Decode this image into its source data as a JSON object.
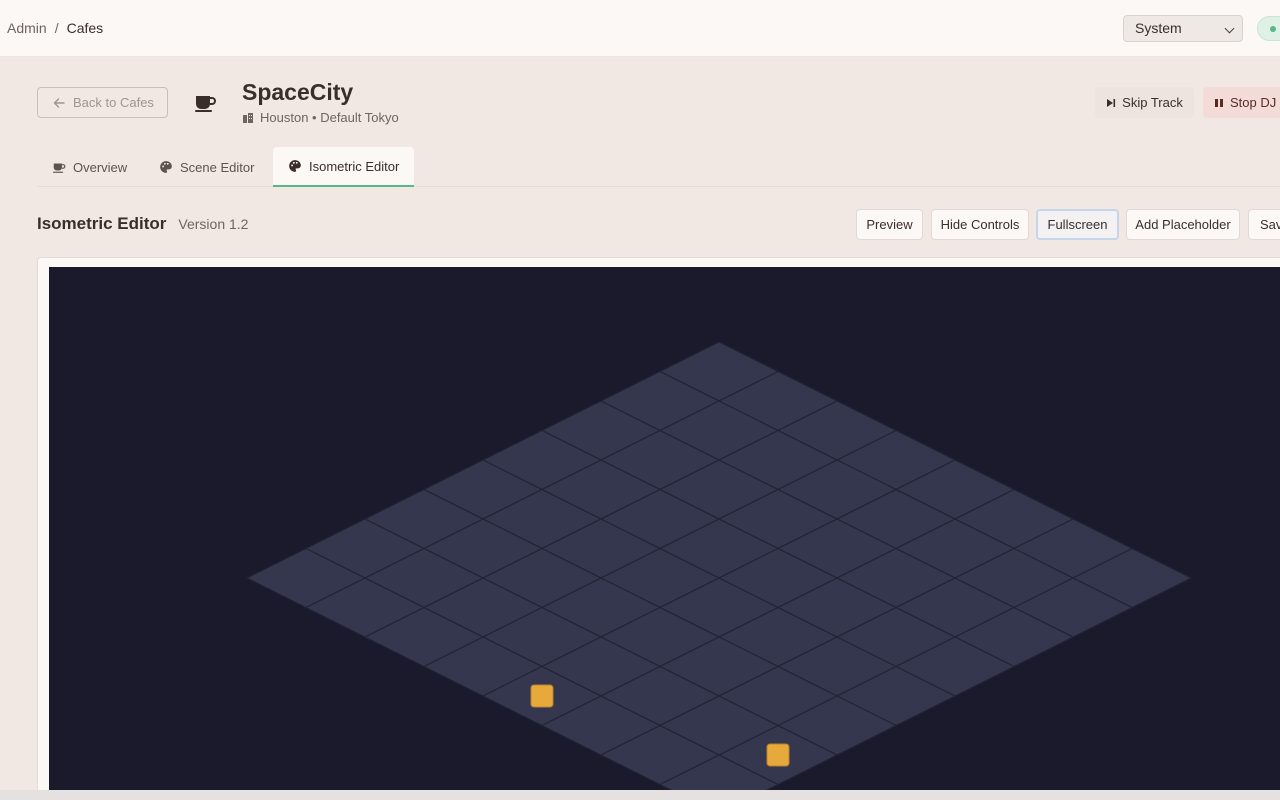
{
  "breadcrumb": {
    "root": "Admin",
    "separator": "/",
    "current": "Cafes"
  },
  "theme_select": {
    "value": "System"
  },
  "header": {
    "back_label": "Back to Cafes",
    "cafe_name": "SpaceCity",
    "cafe_location": "Houston • Default Tokyo",
    "skip_label": "Skip Track",
    "stop_label": "Stop DJ"
  },
  "tabs": [
    {
      "label": "Overview",
      "icon": "cup-icon"
    },
    {
      "label": "Scene Editor",
      "icon": "palette-icon"
    },
    {
      "label": "Isometric Editor",
      "icon": "palette-icon",
      "active": true
    }
  ],
  "editor": {
    "title": "Isometric Editor",
    "version": "Version 1.2",
    "buttons": {
      "preview": "Preview",
      "hide_controls": "Hide Controls",
      "fullscreen": "Fullscreen",
      "add_placeholder": "Add Placeholder",
      "save": "Sav"
    }
  },
  "grid": {
    "rows": 8,
    "cols": 8,
    "tile_color": "#35374f",
    "line_color": "#222335",
    "background": "#1b1a2c",
    "placeholders": [
      {
        "row": 7,
        "col": 4,
        "color": "#e7a83c"
      },
      {
        "row": 6,
        "col": 7,
        "color": "#e7a83c"
      }
    ]
  }
}
